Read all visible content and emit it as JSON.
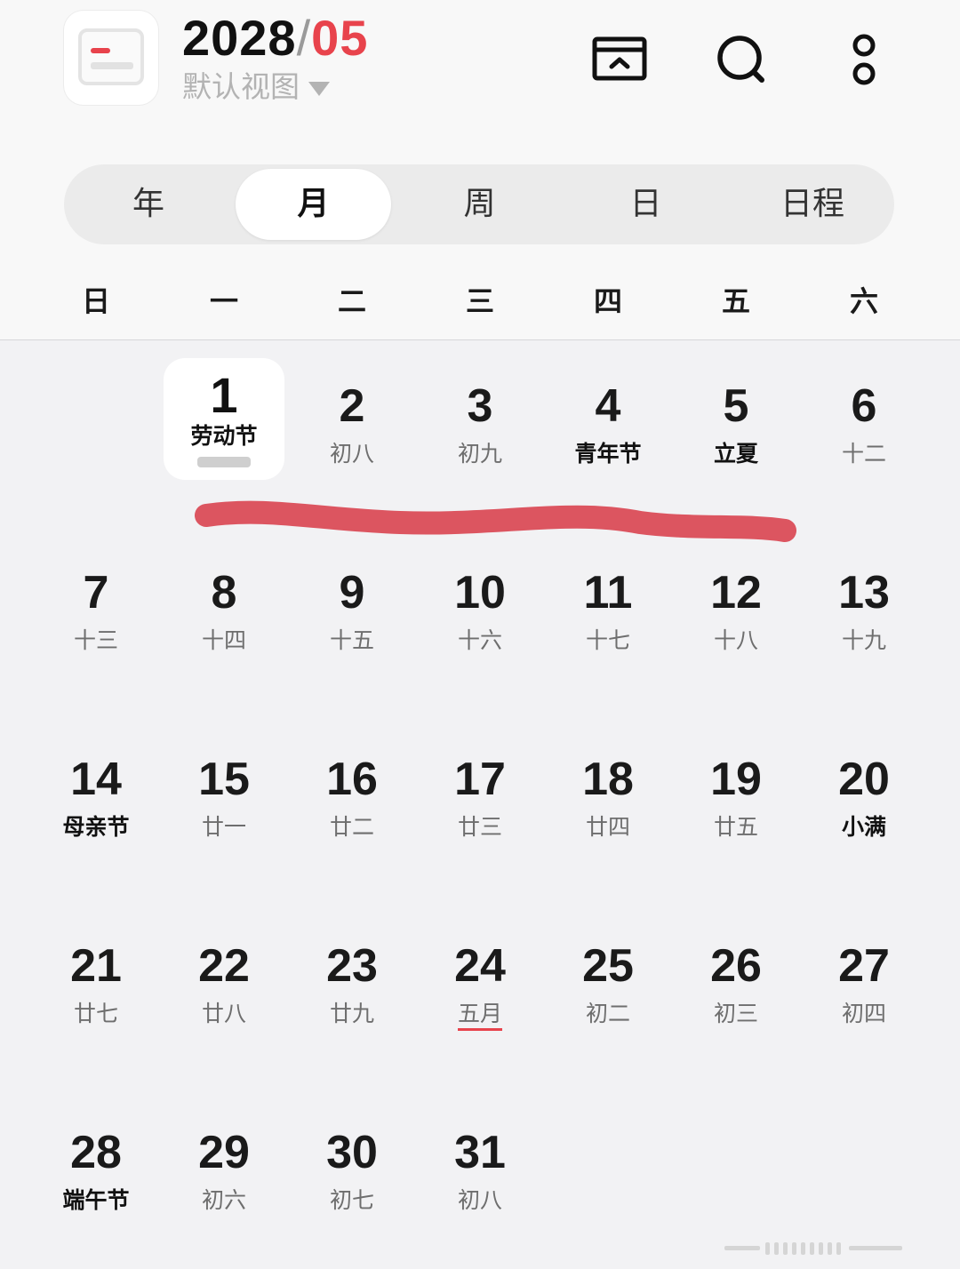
{
  "header": {
    "year": "2028",
    "separator": "/",
    "month": "05",
    "view_label": "默认视图"
  },
  "toolbar": {
    "today_icon": "back-to-today-icon",
    "search_icon": "search-icon",
    "more_icon": "more-icon"
  },
  "tabs": [
    "年",
    "月",
    "周",
    "日",
    "日程"
  ],
  "active_tab": "月",
  "weekdays": [
    "日",
    "一",
    "二",
    "三",
    "四",
    "五",
    "六"
  ],
  "today": {
    "day": "1",
    "label": "劳动节"
  },
  "weeks": [
    [
      null,
      {
        "day": "1",
        "label": "劳动节",
        "holiday": true
      },
      {
        "day": "2",
        "label": "初八"
      },
      {
        "day": "3",
        "label": "初九"
      },
      {
        "day": "4",
        "label": "青年节",
        "holiday": true
      },
      {
        "day": "5",
        "label": "立夏",
        "holiday": true
      },
      {
        "day": "6",
        "label": "十二"
      }
    ],
    [
      {
        "day": "7",
        "label": "十三"
      },
      {
        "day": "8",
        "label": "十四"
      },
      {
        "day": "9",
        "label": "十五"
      },
      {
        "day": "10",
        "label": "十六"
      },
      {
        "day": "11",
        "label": "十七"
      },
      {
        "day": "12",
        "label": "十八"
      },
      {
        "day": "13",
        "label": "十九"
      }
    ],
    [
      {
        "day": "14",
        "label": "母亲节",
        "holiday": true
      },
      {
        "day": "15",
        "label": "廿一"
      },
      {
        "day": "16",
        "label": "廿二"
      },
      {
        "day": "17",
        "label": "廿三"
      },
      {
        "day": "18",
        "label": "廿四"
      },
      {
        "day": "19",
        "label": "廿五"
      },
      {
        "day": "20",
        "label": "小满",
        "holiday": true
      }
    ],
    [
      {
        "day": "21",
        "label": "廿七"
      },
      {
        "day": "22",
        "label": "廿八"
      },
      {
        "day": "23",
        "label": "廿九"
      },
      {
        "day": "24",
        "label": "五月",
        "underline": true
      },
      {
        "day": "25",
        "label": "初二"
      },
      {
        "day": "26",
        "label": "初三"
      },
      {
        "day": "27",
        "label": "初四"
      }
    ],
    [
      {
        "day": "28",
        "label": "端午节",
        "holiday": true
      },
      {
        "day": "29",
        "label": "初六"
      },
      {
        "day": "30",
        "label": "初七"
      },
      {
        "day": "31",
        "label": "初八"
      },
      null,
      null,
      null
    ]
  ],
  "colors": {
    "accent": "#e8434c",
    "annotation_stroke": "#dc5560"
  }
}
